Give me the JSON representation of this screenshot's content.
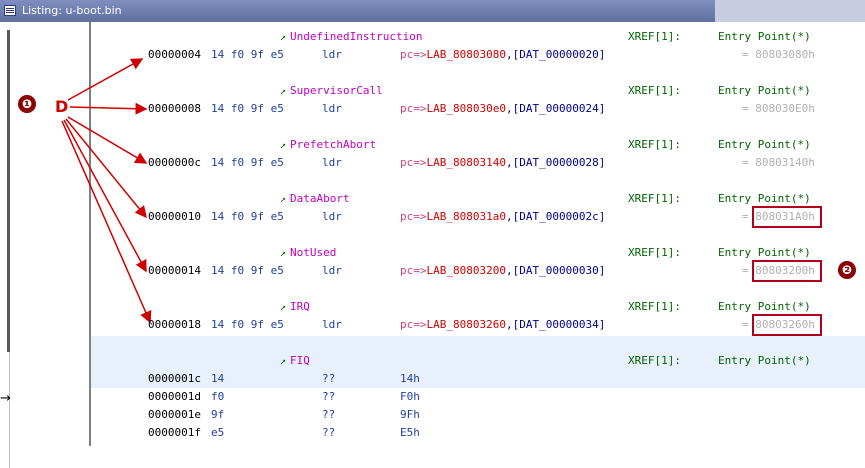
{
  "window": {
    "title": "Listing:  u-boot.bin"
  },
  "gutter": {
    "arrow_glyph": "→"
  },
  "annotation": {
    "letter": "D",
    "marker1": "❶",
    "marker2": "❷",
    "color": "#d00000"
  },
  "entries": [
    {
      "label": "UndefinedInstruction",
      "addr": "00000004",
      "bytes": "14 f0 9f e5",
      "mnem": "ldr",
      "op_pc": "pc",
      "op_arrow": "=>",
      "op_lab": "LAB_80803080",
      "op_dat": "[DAT_00000020]",
      "xref": "XREF[1]:",
      "entry": "Entry Point(*)",
      "eq": "= 80803080h"
    },
    {
      "label": "SupervisorCall",
      "addr": "00000008",
      "bytes": "14 f0 9f e5",
      "mnem": "ldr",
      "op_pc": "pc",
      "op_arrow": "=>",
      "op_lab": "LAB_808030e0",
      "op_dat": "[DAT_00000024]",
      "xref": "XREF[1]:",
      "entry": "Entry Point(*)",
      "eq": "= 808030E0h"
    },
    {
      "label": "PrefetchAbort",
      "addr": "0000000c",
      "bytes": "14 f0 9f e5",
      "mnem": "ldr",
      "op_pc": "pc",
      "op_arrow": "=>",
      "op_lab": "LAB_80803140",
      "op_dat": "[DAT_00000028]",
      "xref": "XREF[1]:",
      "entry": "Entry Point(*)",
      "eq": "= 80803140h"
    },
    {
      "label": "DataAbort",
      "addr": "00000010",
      "bytes": "14 f0 9f e5",
      "mnem": "ldr",
      "op_pc": "pc",
      "op_arrow": "=>",
      "op_lab": "LAB_808031a0",
      "op_dat": "[DAT_0000002c]",
      "xref": "XREF[1]:",
      "entry": "Entry Point(*)",
      "eq": "= 808031A0h"
    },
    {
      "label": "NotUsed",
      "addr": "00000014",
      "bytes": "14 f0 9f e5",
      "mnem": "ldr",
      "op_pc": "pc",
      "op_arrow": "=>",
      "op_lab": "LAB_80803200",
      "op_dat": "[DAT_00000030]",
      "xref": "XREF[1]:",
      "entry": "Entry Point(*)",
      "eq": "= 80803200h"
    },
    {
      "label": "IRQ",
      "addr": "00000018",
      "bytes": "14 f0 9f e5",
      "mnem": "ldr",
      "op_pc": "pc",
      "op_arrow": "=>",
      "op_lab": "LAB_80803260",
      "op_dat": "[DAT_00000034]",
      "xref": "XREF[1]:",
      "entry": "Entry Point(*)",
      "eq": "= 80803260h"
    }
  ],
  "fiq": {
    "label": "FIQ",
    "xref": "XREF[1]:",
    "entry": "Entry Point(*)",
    "rows": [
      {
        "addr": "0000001c",
        "bytes": "14",
        "mnem": "??",
        "op": "14h"
      },
      {
        "addr": "0000001d",
        "bytes": "f0",
        "mnem": "??",
        "op": "F0h"
      },
      {
        "addr": "0000001e",
        "bytes": "9f",
        "mnem": "??",
        "op": "9Fh"
      },
      {
        "addr": "0000001f",
        "bytes": "e5",
        "mnem": "??",
        "op": "E5h"
      }
    ]
  }
}
